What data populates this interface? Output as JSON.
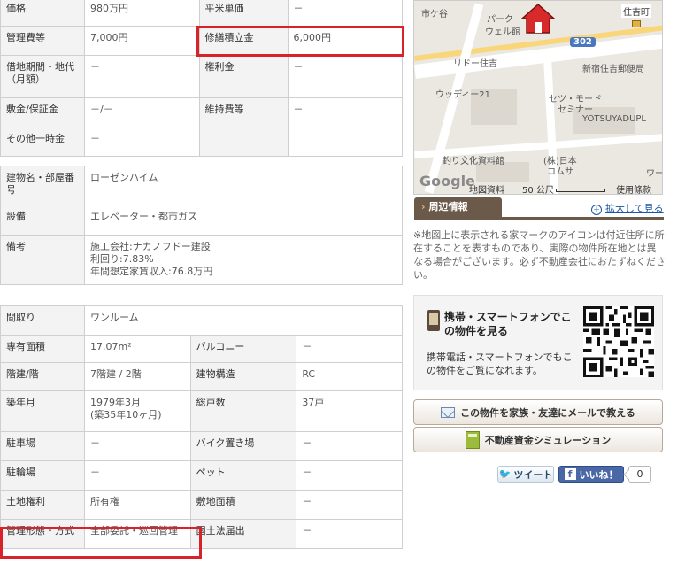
{
  "section1": {
    "rows": [
      {
        "l1": "価格",
        "v1": "980万円",
        "l2": "平米単価",
        "v2": "－"
      },
      {
        "l1": "管理費等",
        "v1": "7,000円",
        "l2": "修繕積立金",
        "v2": "6,000円"
      },
      {
        "l1": "借地期間・地代\n（月額）",
        "v1": "－",
        "l2": "権利金",
        "v2": "－"
      },
      {
        "l1": "敷金/保証金",
        "v1": "－/－",
        "l2": "維持費等",
        "v2": "－"
      },
      {
        "l1": "その他一時金",
        "v1": "－",
        "l2": "",
        "v2": ""
      }
    ]
  },
  "section2": {
    "rows": [
      {
        "label": "建物名・部屋番号",
        "value": "ローゼンハイム"
      },
      {
        "label": "設備",
        "value": "エレベーター・都市ガス"
      },
      {
        "label": "備考",
        "value": "施工会社:ナカノフドー建設\n利回り:7.83%\n年間想定家賃収入:76.8万円"
      }
    ]
  },
  "section3": {
    "layout_label": "間取り",
    "layout_value": "ワンルーム",
    "rows": [
      {
        "l1": "専有面積",
        "v1": "17.07m²",
        "l2": "バルコニー",
        "v2": "－"
      },
      {
        "l1": "階建/階",
        "v1": "7階建 / 2階",
        "l2": "建物構造",
        "v2": "RC"
      },
      {
        "l1": "築年月",
        "v1": "1979年3月\n(築35年10ヶ月)",
        "l2": "総戸数",
        "v2": "37戸"
      },
      {
        "l1": "駐車場",
        "v1": "－",
        "l2": "バイク置き場",
        "v2": "－"
      },
      {
        "l1": "駐輪場",
        "v1": "－",
        "l2": "ペット",
        "v2": "－"
      },
      {
        "l1": "土地権利",
        "v1": "所有権",
        "l2": "敷地面積",
        "v2": "－"
      },
      {
        "l1": "管理形態・方式",
        "v1": "全部委託・巡回管理",
        "l2": "国土法届出",
        "v2": "－"
      }
    ]
  },
  "map": {
    "labels": {
      "town": "市ケ谷",
      "park": "パーク",
      "park2": "ウェル館",
      "sumiyoshi": "住吉町",
      "route": "302",
      "lido": "リドー住吉",
      "post": "新宿住吉郵便局",
      "woody": "ウッディー21",
      "seto1": "セツ・モード",
      "seto2": "セミナー",
      "yotsuya": "YOTSUYADUPL",
      "fishing": "釣り文化資料館",
      "comsa1": "(株)日本",
      "comsa2": "コムサ",
      "wa": "ワー",
      "google": "Google",
      "credit": "地図資料",
      "scale": "50 公尺",
      "terms": "使用條款"
    }
  },
  "nearby": {
    "tab_label": "周辺情報",
    "enlarge_label": "拡大して見る"
  },
  "note": "※地図上に表示される家マークのアイコンは付近住所に所在することを表すものであり、実際の物件所在地とは異なる場合がございます。必ず不動産会社におたずねください。",
  "mobile": {
    "title": "携帯・スマートフォンでこの物件を見る",
    "description": "携帯電話・スマートフォンでもこの物件をご覧になれます。"
  },
  "buttons": {
    "email": "この物件を家族・友達にメールで教える",
    "simulation": "不動産資金シミュレーション"
  },
  "social": {
    "tweet": "ツイート",
    "like": "いいね！",
    "like_count": "0"
  },
  "colors": {
    "highlight": "#d8232a",
    "tab": "#6b5a4a",
    "link": "#1a56a8"
  }
}
